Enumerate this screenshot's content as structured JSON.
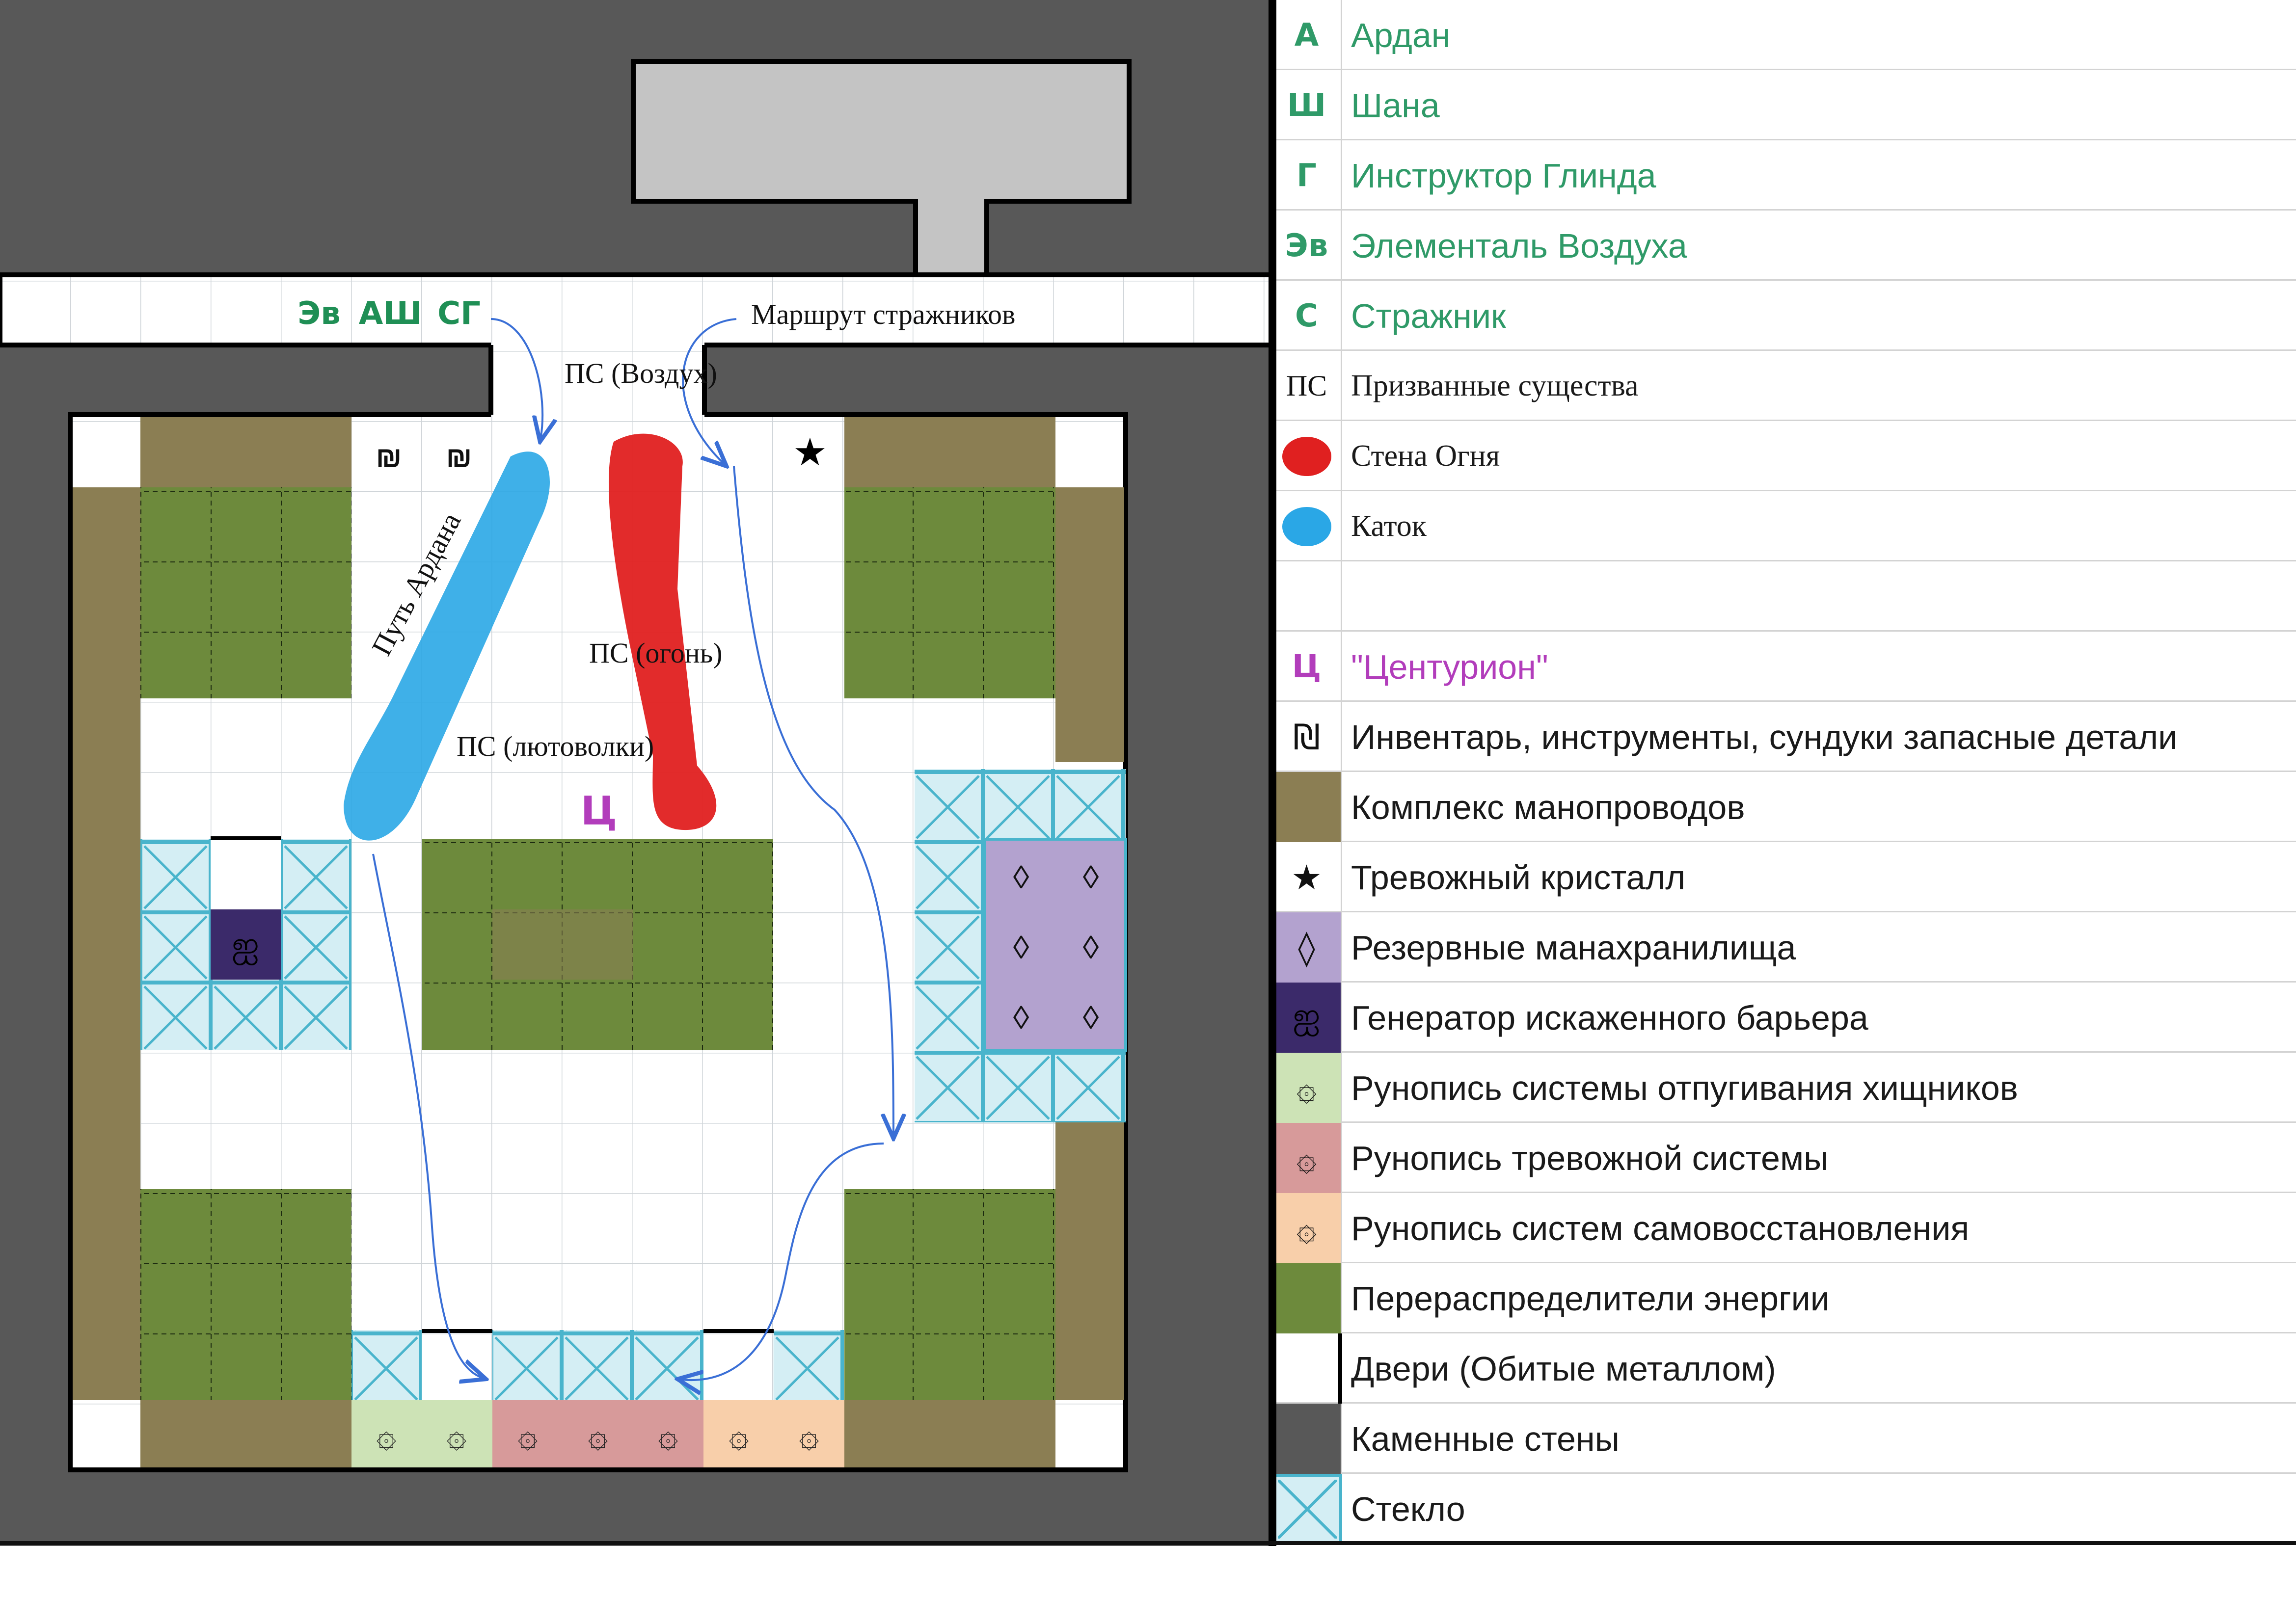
{
  "map": {
    "corridor_markers": [
      "Эв",
      "АШ",
      "СГ"
    ],
    "guard_route_label": "Маршрут стражников",
    "summon_air_label": "ПС (Воздух)",
    "ardan_path_label": "Путь Ардана",
    "summon_fire_label": "ПС (огонь)",
    "summon_wolves_label": "ПС (лютоволки)",
    "centurion_marker": "Ц",
    "inventory_glyph": "₪",
    "star_glyph": "★",
    "reserve_glyph": "◊",
    "barrier_glyph": "ஐ",
    "rune_glyph": "۞"
  },
  "colors": {
    "stone": "#585858",
    "building": "#c4c4c4",
    "pipes": "#8b7e53",
    "energy": "#6d8a3c",
    "glass": "#d4eef4",
    "glass_border": "#49b4cc",
    "reserve": "#b3a2cf",
    "barrier": "#3b2a6a",
    "rune_green": "#cde3b6",
    "rune_red": "#d79a9a",
    "rune_peach": "#f8cfaa",
    "fire": "#e02020",
    "ice": "#2aa7e6",
    "route": "#3a6fd6",
    "magenta": "#b23dbb",
    "green_text": "#2f9a68"
  },
  "legend": [
    {
      "code": "А",
      "label": "Ардан"
    },
    {
      "code": "Ш",
      "label": "Шана"
    },
    {
      "code": "Г",
      "label": "Инструктор Глинда"
    },
    {
      "code": "Эв",
      "label": "Элементаль Воздуха"
    },
    {
      "code": "С",
      "label": "Стражник"
    },
    {
      "code": "ПС",
      "label": "Призванные существа"
    },
    {
      "label": "Стена Огня"
    },
    {
      "label": "Каток"
    },
    {
      "label": ""
    },
    {
      "code": "Ц",
      "label": "\"Центурион\""
    },
    {
      "code": "₪",
      "label": "Инвентарь, инструменты, сундуки запасные детали"
    },
    {
      "label": "Комплекс манопроводов"
    },
    {
      "code": "★",
      "label": "Тревожный кристалл"
    },
    {
      "code": "◊",
      "label": "Резервные манахранилища"
    },
    {
      "code": "ஐ",
      "label": "Генератор искаженного барьера"
    },
    {
      "code": "۞",
      "label": "Рунопись системы отпугивания хищников"
    },
    {
      "code": "۞",
      "label": "Рунопись тревожной системы"
    },
    {
      "code": "۞",
      "label": "Рунопись систем самовосстановления"
    },
    {
      "label": "Перераспределители энергии"
    },
    {
      "label": "Двери (Обитые металлом)"
    },
    {
      "label": "Каменные стены"
    },
    {
      "label": "Стекло"
    }
  ]
}
